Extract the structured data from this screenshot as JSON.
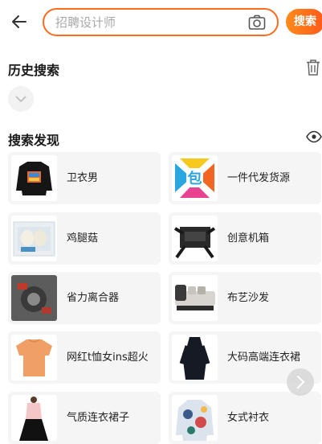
{
  "header": {
    "search_placeholder": "招聘设计师",
    "search_button": "搜索"
  },
  "history": {
    "title": "历史搜索"
  },
  "discover": {
    "title": "搜索发现",
    "items": [
      {
        "label": "卫衣男"
      },
      {
        "label": "一件代发货源"
      },
      {
        "label": "鸡腿菇"
      },
      {
        "label": "创意机箱"
      },
      {
        "label": "省力离合器"
      },
      {
        "label": "布艺沙发"
      },
      {
        "label": "网红t恤女ins超火"
      },
      {
        "label": "大码高端连衣裙"
      },
      {
        "label": "气质连衣裙子"
      },
      {
        "label": "女式衬衣"
      }
    ]
  },
  "colors": {
    "accent": "#ff6a1f",
    "card_bg": "#f5f5f5"
  }
}
